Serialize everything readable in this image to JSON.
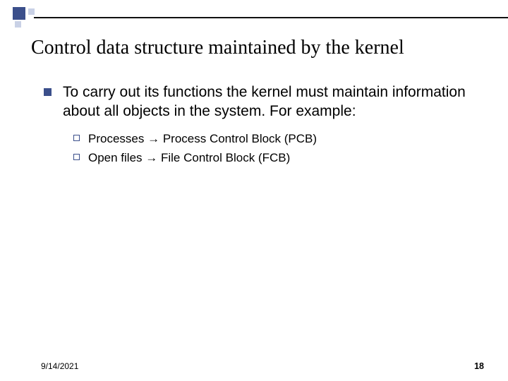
{
  "title": "Control data structure maintained by the kernel",
  "bullets": [
    {
      "text": "To carry out its functions the kernel must maintain information about all objects in the system. For example:",
      "sub": [
        {
          "before": "Processes ",
          "arrow": "→",
          "after": " Process Control Block (PCB)"
        },
        {
          "before": "Open files ",
          "arrow": "→",
          "after": " File Control Block (FCB)"
        }
      ]
    }
  ],
  "footer": {
    "date": "9/14/2021",
    "page": "18"
  }
}
